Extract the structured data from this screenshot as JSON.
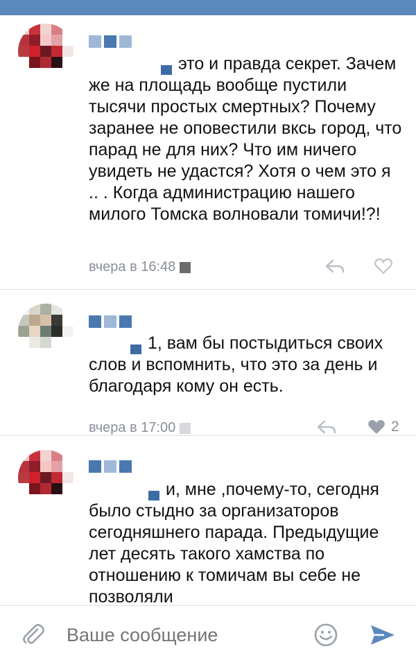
{
  "comments": [
    {
      "author": "",
      "text_after_mention": "это и правда секрет. Зачем же на площадь вообще пустили тысячи простых смертных? Почему заранее не оповестили вксь город, что парад не для них? Что им ничего увидеть не удастся? Хотя о чем это я .. . Когда администрацию нашего милого Томска волновали томичи!?!",
      "time": "вчера в 16:48",
      "likes": ""
    },
    {
      "author": "",
      "text_after_mention": "1, вам бы постыдиться своих слов и вспомнить, что это за день и благодаря кому он есть.",
      "time": "вчера в 17:00",
      "likes": "2"
    },
    {
      "author": "",
      "text_after_mention": "и, мне ,почему-то, сегодня было стыдно за организаторов сегодняшнего парада. Предыдущие лет десять такого хамства по отношению к томичам вы себе не позволяли",
      "time": "",
      "likes": ""
    }
  ],
  "composer": {
    "placeholder": "Ваше сообщение"
  },
  "icons": {
    "attach": "paperclip-icon",
    "emoji": "smile-icon",
    "send": "send-icon",
    "reply": "reply-icon",
    "like": "heart-icon"
  },
  "colors": {
    "header": "#5b88bd",
    "link": "#3d6ca5",
    "meta": "#8a8f99",
    "accent": "#4a78b1"
  }
}
